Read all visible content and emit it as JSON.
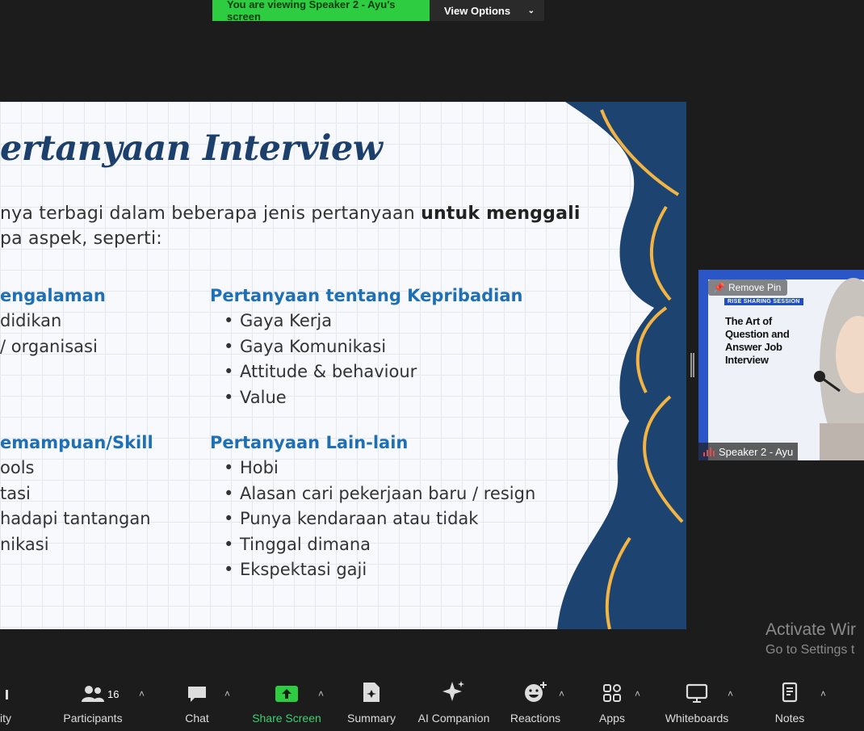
{
  "banner": {
    "viewing_text": "You are viewing Speaker 2 - Ayu's screen",
    "view_options_label": "View Options",
    "green_color": "#2ecc40"
  },
  "slide": {
    "title": "ertanyaan Interview",
    "intro_line1_plain": "nya terbagi dalam beberapa jenis pertanyaan ",
    "intro_line1_bold": "untuk menggali",
    "intro_line2": "pa aspek, seperti:",
    "sections": [
      {
        "title": "engalaman",
        "bulleted": false,
        "items": [
          "didikan",
          "/ organisasi"
        ]
      },
      {
        "title": "Pertanyaan tentang Kepribadian",
        "bulleted": true,
        "items": [
          "Gaya Kerja",
          "Gaya Komunikasi",
          "Attitude & behaviour",
          "Value"
        ]
      },
      {
        "title": "emampuan/Skill",
        "bulleted": false,
        "items": [
          "ools",
          "tasi",
          "hadapi tantangan",
          "nikasi"
        ]
      },
      {
        "title": "Pertanyaan Lain-lain",
        "bulleted": true,
        "items": [
          "Hobi",
          "Alasan cari pekerjaan baru / resign",
          "Punya kendaraan atau tidak",
          "Tinggal dimana",
          "Ekspektasi gaji"
        ]
      }
    ],
    "colors": {
      "title": "#1c3f6b",
      "section": "#1f6fb3",
      "navy": "#1d4471",
      "gold": "#f2b442"
    }
  },
  "thumbnail": {
    "remove_pin_label": "Remove Pin",
    "tag": "RISE SHARING SESSION",
    "title": "The Art of Question and Answer Job Interview",
    "speaker_name": "Speaker 2 - Ayu"
  },
  "watermark": {
    "line1": "Activate Wir",
    "line2": "Go to Settings t"
  },
  "toolbar": {
    "partial_left_label": "ity",
    "items": [
      {
        "label": "Participants",
        "icon": "participants-icon",
        "count": "16"
      },
      {
        "label": "Chat",
        "icon": "chat-icon"
      },
      {
        "label": "Share Screen",
        "icon": "share-screen-icon"
      },
      {
        "label": "Summary",
        "icon": "summary-icon"
      },
      {
        "label": "AI Companion",
        "icon": "ai-companion-icon"
      },
      {
        "label": "Reactions",
        "icon": "reactions-icon"
      },
      {
        "label": "Apps",
        "icon": "apps-icon"
      },
      {
        "label": "Whiteboards",
        "icon": "whiteboards-icon"
      },
      {
        "label": "Notes",
        "icon": "notes-icon"
      }
    ]
  }
}
